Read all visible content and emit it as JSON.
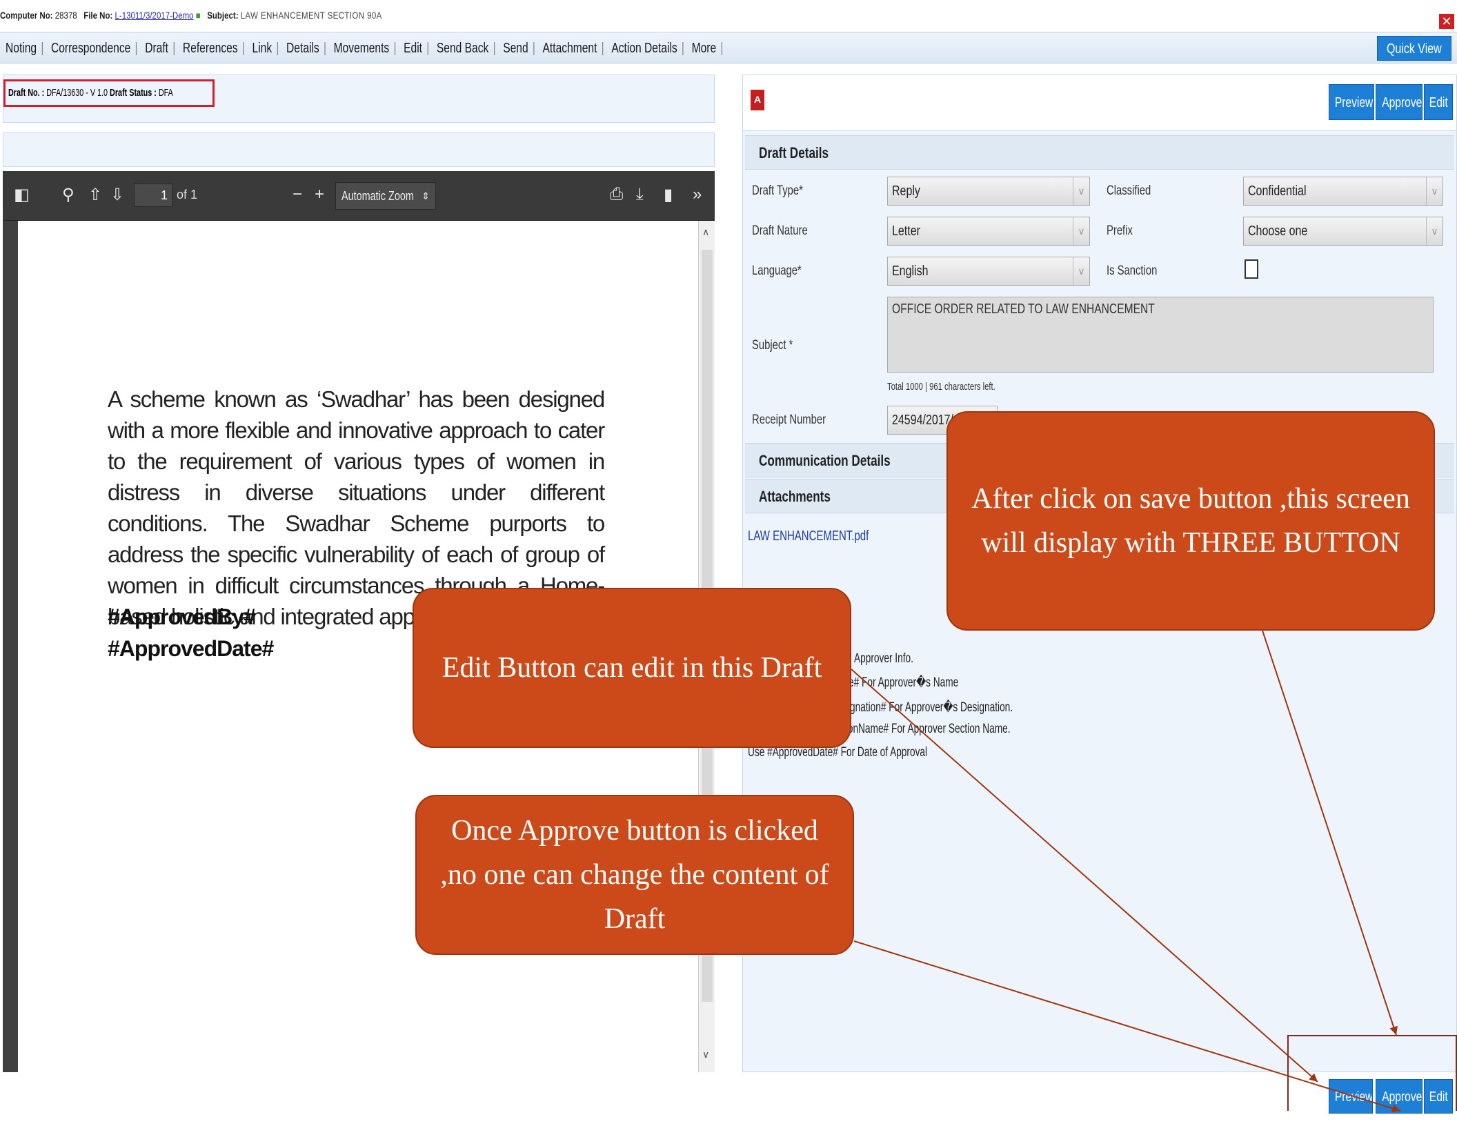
{
  "header": {
    "computer_no_label": "Computer No:",
    "computer_no": "28378",
    "file_no_label": "File No:",
    "file_no": "L-13011/3/2017-Demo",
    "subject_label": "Subject:",
    "subject": "LAW ENHANCEMENT SECTION 90A",
    "close_icon": "close-icon"
  },
  "menu": {
    "items": [
      "Noting",
      "Correspondence",
      "Draft",
      "References",
      "Link",
      "Details",
      "Movements",
      "Edit",
      "Send Back",
      "Send",
      "Attachment",
      "Action Details",
      "More"
    ],
    "quick_view": "Quick View"
  },
  "draft_info": {
    "draft_no_label": "Draft No. :",
    "draft_no": "DFA/13630 - V 1.0",
    "draft_status_label": "Draft Status :",
    "draft_status": "DFA"
  },
  "pdf_viewer": {
    "page_number": "1",
    "page_of": "of 1",
    "zoom": "Automatic Zoom",
    "body_text": "A scheme known as ‘Swadhar’ has been designed with a more flexible and innovative approach to cater to the requirement of various types of women in distress in diverse situations under different conditions. The Swadhar Scheme purports to address the specific vulnerability of each of group of women in difficult circumstances through a Home-based holistic and integrated approach.",
    "placeholder1": "#ApprovedBy#",
    "placeholder2": "#ApprovedDate#"
  },
  "actions": {
    "preview": "Preview",
    "approve": "Approve",
    "edit": "Edit"
  },
  "draft_details": {
    "title": "Draft Details",
    "draft_type_label": "Draft Type*",
    "draft_type": "Reply",
    "classified_label": "Classified",
    "classified": "Confidential",
    "draft_nature_label": "Draft Nature",
    "draft_nature": "Letter",
    "prefix_label": "Prefix",
    "prefix": "Choose one",
    "language_label": "Language*",
    "language": "English",
    "is_sanction_label": "Is Sanction",
    "subject_label": "Subject *",
    "subject": "OFFICE ORDER RELATED TO LAW ENHANCEMENT",
    "char_count": "Total 1000 |   961    characters left.",
    "receipt_number_label": "Receipt Number",
    "receipt_number": "24594/2017/ed"
  },
  "communication": {
    "title": "Communication Details"
  },
  "attachments": {
    "title": "Attachments",
    "file": "LAW ENHANCEMENT.pdf"
  },
  "help": {
    "line1": "Approver Info.",
    "line2": "e# For Approver�s Name",
    "line3": "gnation# For Approver�s Designation.",
    "line4": "tionName# For Approver Section Name.",
    "line5": "Use #ApprovedDate# For Date of Approval"
  },
  "callouts": {
    "save": "After click on save button ,this screen will display with THREE BUTTON",
    "edit": "Edit Button can edit in this Draft",
    "approve": "Once Approve button is clicked ,no one can change the content of Draft"
  },
  "colors": {
    "callout": "#cc4a19",
    "button": "#1e7fd6",
    "panel": "#eef4fb",
    "highlight": "#d01f2f"
  }
}
